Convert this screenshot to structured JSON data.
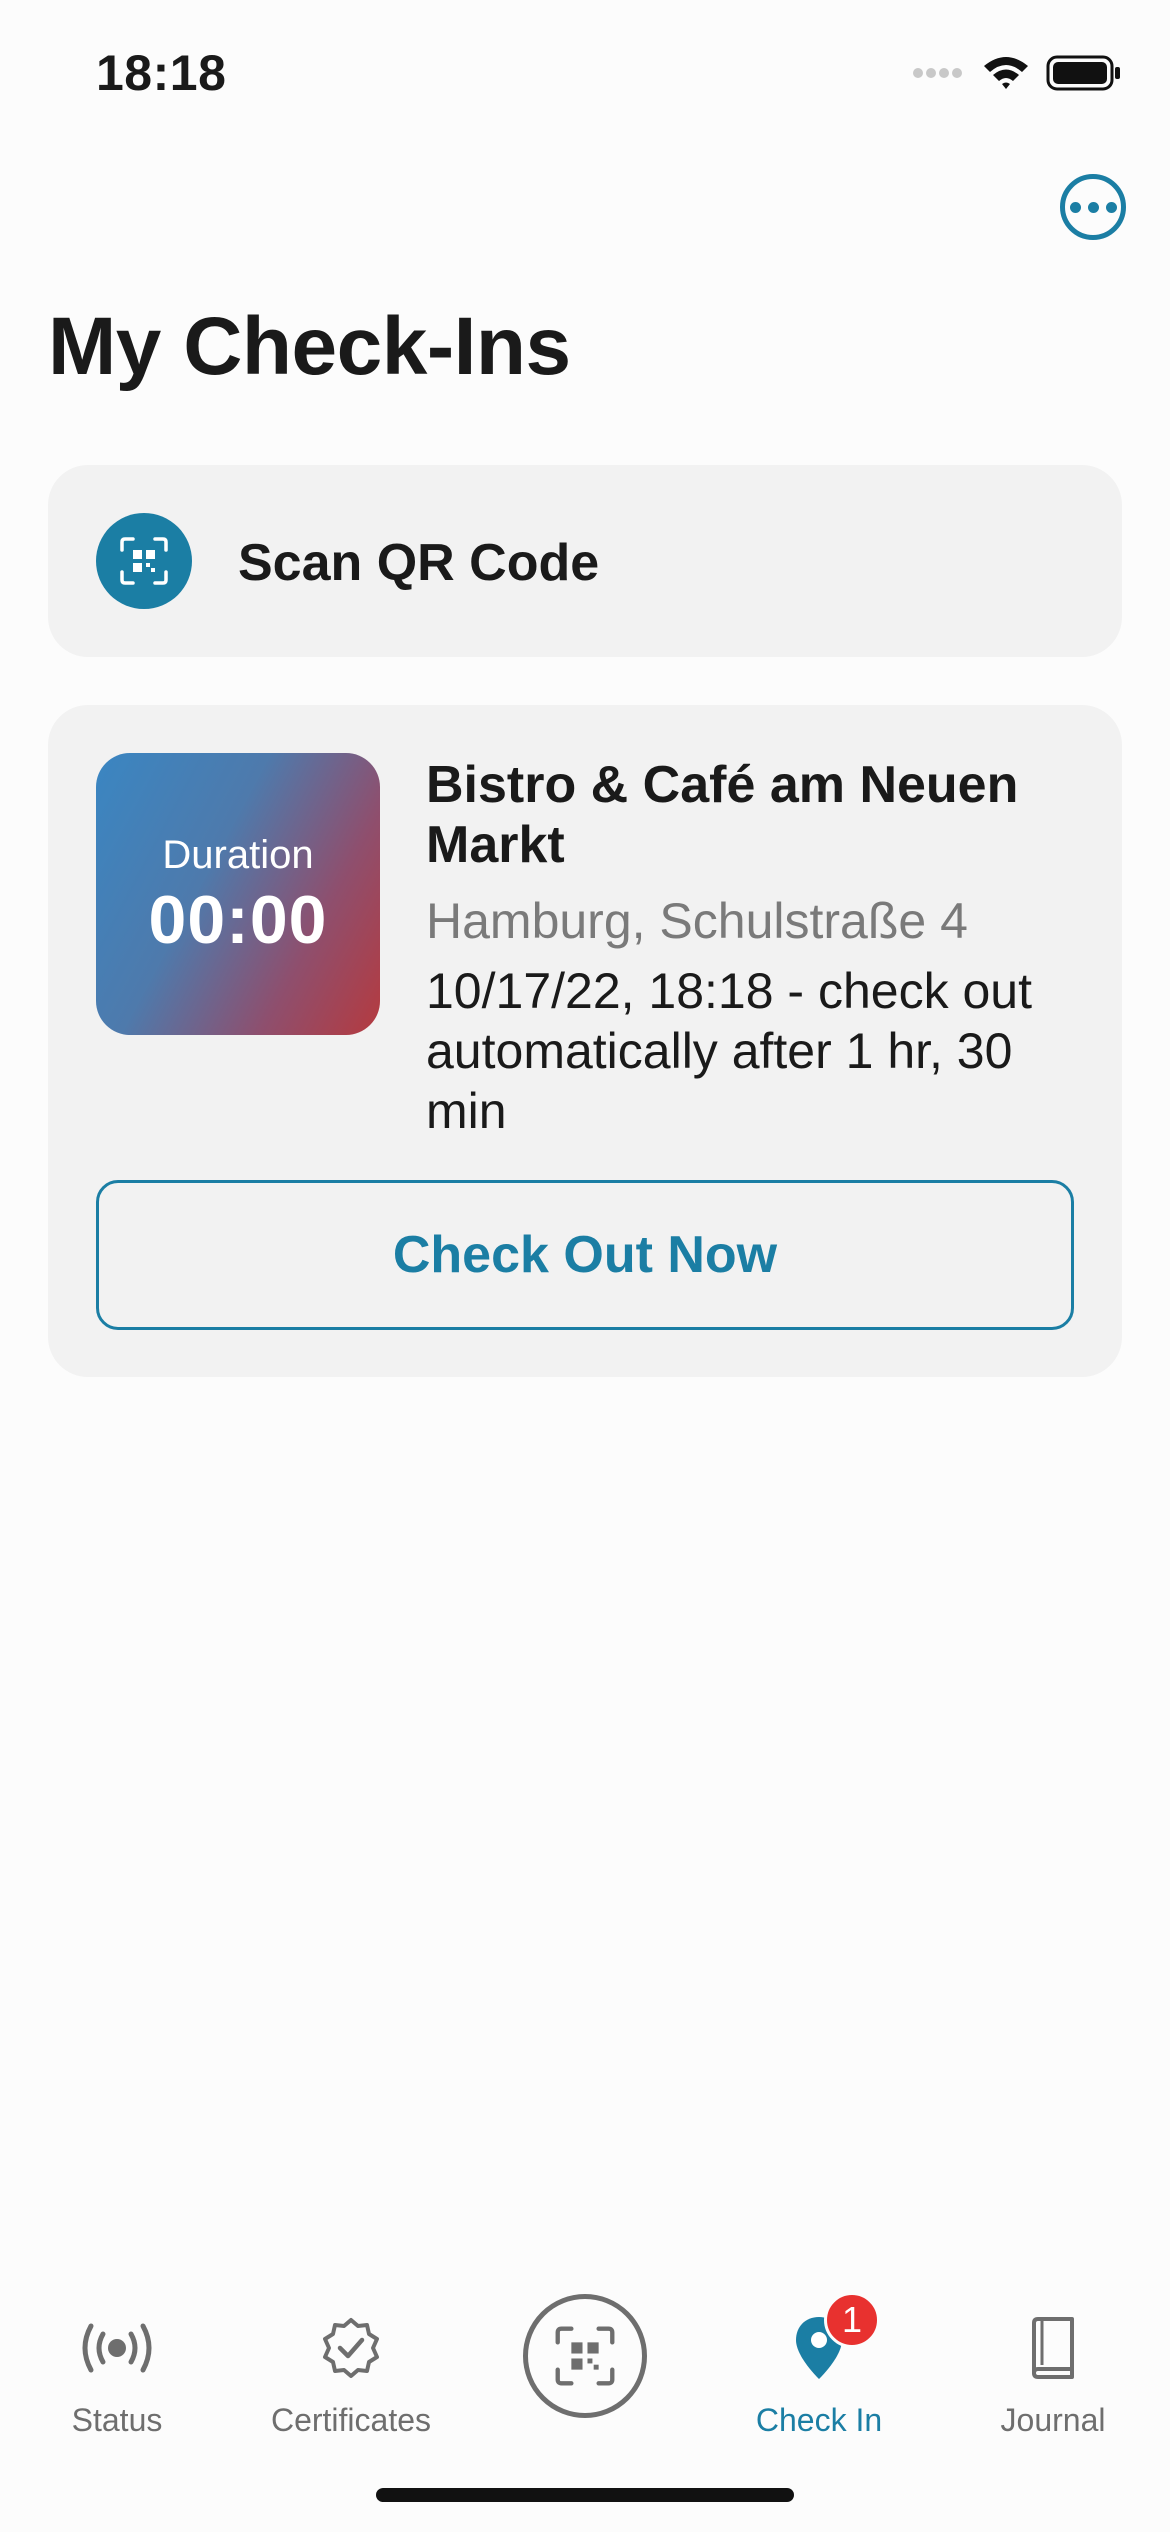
{
  "status_bar": {
    "time": "18:18"
  },
  "page": {
    "title": "My Check-Ins"
  },
  "scan_card": {
    "label": "Scan QR Code"
  },
  "checkin": {
    "duration_label": "Duration",
    "duration_value": "00:00",
    "venue_name": "Bistro & Café am Neuen Markt",
    "address": "Hamburg, Schulstraße 4",
    "info": "10/17/22, 18:18 - check out automatically after 1 hr, 30 min",
    "checkout_label": "Check Out Now"
  },
  "tab_bar": {
    "items": [
      {
        "label": "Status",
        "icon": "broadcast-icon"
      },
      {
        "label": "Certificates",
        "icon": "certificate-icon"
      },
      {
        "label": "",
        "icon": "qr-scan-icon"
      },
      {
        "label": "Check In",
        "icon": "location-pin-icon",
        "badge": "1",
        "active": true
      },
      {
        "label": "Journal",
        "icon": "book-icon"
      }
    ]
  },
  "colors": {
    "accent": "#1b7ea4",
    "badge": "#e8312f",
    "card": "#f2f2f2"
  }
}
